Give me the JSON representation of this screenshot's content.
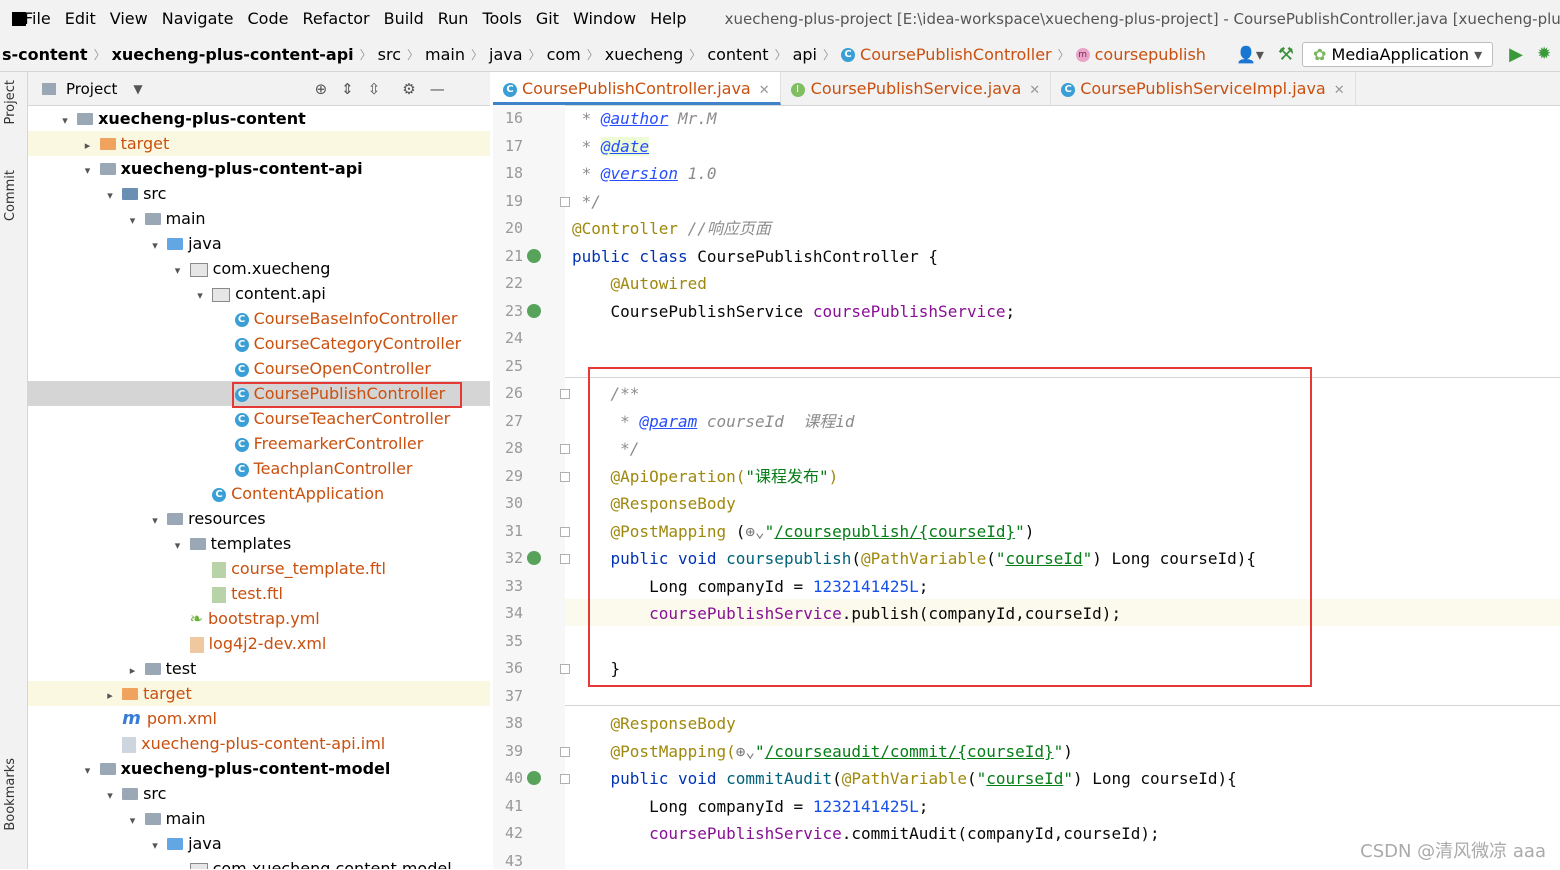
{
  "menu": {
    "items": [
      "File",
      "Edit",
      "View",
      "Navigate",
      "Code",
      "Refactor",
      "Build",
      "Run",
      "Tools",
      "Git",
      "Window",
      "Help"
    ],
    "window_title": "xuecheng-plus-project [E:\\idea-workspace\\xuecheng-plus-project] - CoursePublishController.java [xuecheng-plu"
  },
  "breadcrumb": [
    "s-content",
    "xuecheng-plus-content-api",
    "src",
    "main",
    "java",
    "com",
    "xuecheng",
    "content",
    "api",
    "CoursePublishController",
    "coursepublish"
  ],
  "run_config": "MediaApplication",
  "project_panel": {
    "title": "Project"
  },
  "side_tabs": {
    "project": "Project",
    "commit": "Commit",
    "bookmarks": "Bookmarks"
  },
  "tree": [
    {
      "label": "xuecheng-plus-content",
      "indent": 0,
      "arrow": "▾",
      "icon": "module",
      "bold": true
    },
    {
      "label": "target",
      "indent": 1,
      "arrow": "▸",
      "icon": "orange",
      "yellow": true,
      "orange": true
    },
    {
      "label": "xuecheng-plus-content-api",
      "indent": 1,
      "arrow": "▾",
      "icon": "module",
      "bold": true
    },
    {
      "label": "src",
      "indent": 2,
      "arrow": "▾",
      "icon": "src"
    },
    {
      "label": "main",
      "indent": 3,
      "arrow": "▾",
      "icon": "folder"
    },
    {
      "label": "java",
      "indent": 4,
      "arrow": "▾",
      "icon": "java"
    },
    {
      "label": "com.xuecheng",
      "indent": 5,
      "arrow": "▾",
      "icon": "pkg"
    },
    {
      "label": "content.api",
      "indent": 6,
      "arrow": "▾",
      "icon": "pkg"
    },
    {
      "label": "CourseBaseInfoController",
      "indent": 7,
      "arrow": "",
      "icon": "class",
      "orange": true
    },
    {
      "label": "CourseCategoryController",
      "indent": 7,
      "arrow": "",
      "icon": "class",
      "orange": true
    },
    {
      "label": "CourseOpenController",
      "indent": 7,
      "arrow": "",
      "icon": "class",
      "orange": true
    },
    {
      "label": "CoursePublishController",
      "indent": 7,
      "arrow": "",
      "icon": "class",
      "orange": true,
      "selected": true
    },
    {
      "label": "CourseTeacherController",
      "indent": 7,
      "arrow": "",
      "icon": "class",
      "orange": true
    },
    {
      "label": "FreemarkerController",
      "indent": 7,
      "arrow": "",
      "icon": "class",
      "orange": true
    },
    {
      "label": "TeachplanController",
      "indent": 7,
      "arrow": "",
      "icon": "class",
      "orange": true
    },
    {
      "label": "ContentApplication",
      "indent": 6,
      "arrow": "",
      "icon": "app",
      "orange": true
    },
    {
      "label": "resources",
      "indent": 4,
      "arrow": "▾",
      "icon": "folder"
    },
    {
      "label": "templates",
      "indent": 5,
      "arrow": "▾",
      "icon": "folder"
    },
    {
      "label": "course_template.ftl",
      "indent": 6,
      "arrow": "",
      "icon": "ftl",
      "orange": true
    },
    {
      "label": "test.ftl",
      "indent": 6,
      "arrow": "",
      "icon": "ftl",
      "orange": true
    },
    {
      "label": "bootstrap.yml",
      "indent": 5,
      "arrow": "",
      "icon": "yml",
      "orange": true
    },
    {
      "label": "log4j2-dev.xml",
      "indent": 5,
      "arrow": "",
      "icon": "xml",
      "orange": true
    },
    {
      "label": "test",
      "indent": 3,
      "arrow": "▸",
      "icon": "folder"
    },
    {
      "label": "target",
      "indent": 2,
      "arrow": "▸",
      "icon": "orange",
      "yellow": true,
      "orange": true
    },
    {
      "label": "pom.xml",
      "indent": 2,
      "arrow": "",
      "icon": "maven",
      "orange": true
    },
    {
      "label": "xuecheng-plus-content-api.iml",
      "indent": 2,
      "arrow": "",
      "icon": "iml",
      "orange": true
    },
    {
      "label": "xuecheng-plus-content-model",
      "indent": 1,
      "arrow": "▾",
      "icon": "module",
      "bold": true
    },
    {
      "label": "src",
      "indent": 2,
      "arrow": "▾",
      "icon": "folder"
    },
    {
      "label": "main",
      "indent": 3,
      "arrow": "▾",
      "icon": "folder"
    },
    {
      "label": "java",
      "indent": 4,
      "arrow": "▾",
      "icon": "java"
    },
    {
      "label": "com.xuecheng.content.model",
      "indent": 5,
      "arrow": "",
      "icon": "pkg"
    }
  ],
  "tabs": [
    {
      "label": "CoursePublishController.java",
      "icon": "C",
      "active": true
    },
    {
      "label": "CoursePublishService.java",
      "icon": "I",
      "active": false
    },
    {
      "label": "CoursePublishServiceImpl.java",
      "icon": "C",
      "active": false
    }
  ],
  "code_lines": [
    {
      "n": "16",
      "html": "<span class='cm'> * <span class='tag'>@author</span> Mr.M</span>"
    },
    {
      "n": "17",
      "html": "<span class='cm'> * <span class='tag' style='background:#edfcd6'>@date</span></span>"
    },
    {
      "n": "18",
      "html": "<span class='cm'> * <span class='tag'>@version</span> 1.0</span>"
    },
    {
      "n": "19",
      "html": "<span class='cm'> */</span>"
    },
    {
      "n": "20",
      "html": "<span class='ann'>@Controller</span> <span class='cm'>//响应页面</span>"
    },
    {
      "n": "21",
      "html": "<span class='kw'>public class</span> CoursePublishController {"
    },
    {
      "n": "22",
      "html": "    <span class='ann'>@Autowired</span>"
    },
    {
      "n": "23",
      "html": "    CoursePublishService <span class='fld'>coursePublishService</span>;"
    },
    {
      "n": "24",
      "html": ""
    },
    {
      "n": "25",
      "html": ""
    },
    {
      "n": "26",
      "html": "    <span class='cm'>/**</span>"
    },
    {
      "n": "27",
      "html": "<span class='cm'>     * <span class='tag'>@param</span> courseId  课程id</span>"
    },
    {
      "n": "28",
      "html": "<span class='cm'>     */</span>"
    },
    {
      "n": "29",
      "html": "    <span class='ann'>@ApiOperation(</span><span class='str'>\"课程发布\"</span><span class='ann'>)</span>"
    },
    {
      "n": "30",
      "html": "    <span class='ann'>@ResponseBody</span>"
    },
    {
      "n": "31",
      "html": "    <span class='ann'>@PostMapping</span> (<span style='color:#777'>⊕⌄</span><span class='str'>\"<u>/coursepublish/{courseId}</u>\"</span>)"
    },
    {
      "n": "32",
      "html": "    <span class='kw'>public void</span> <span class='mth'>coursepublish</span>(<span class='ann'>@PathVariable</span>(<span class='str'>\"<u>courseId</u>\"</span>) Long courseId){"
    },
    {
      "n": "33",
      "html": "        Long companyId = <span class='num'>1232141425L</span>;"
    },
    {
      "n": "34",
      "html": "        <span class='fld'>coursePublishService</span>.publish(companyId,courseId);"
    },
    {
      "n": "35",
      "html": ""
    },
    {
      "n": "36",
      "html": "    }"
    },
    {
      "n": "37",
      "html": ""
    },
    {
      "n": "38",
      "html": "    <span class='ann'>@ResponseBody</span>"
    },
    {
      "n": "39",
      "html": "    <span class='ann'>@PostMapping(</span><span style='color:#777'>⊕⌄</span><span class='str'>\"<u>/courseaudit/commit/{courseId}</u>\"</span>)"
    },
    {
      "n": "40",
      "html": "    <span class='kw'>public void</span> <span class='mth'>commitAudit</span>(<span class='ann'>@PathVariable</span>(<span class='str'>\"<u>courseId</u>\"</span>) Long courseId){"
    },
    {
      "n": "41",
      "html": "        Long companyId = <span class='num'>1232141425L</span>;"
    },
    {
      "n": "42",
      "html": "        <span class='fld'>coursePublishService</span>.commitAudit(companyId,courseId);"
    },
    {
      "n": "43",
      "html": ""
    }
  ],
  "watermark": "CSDN @清风微凉 aaa"
}
